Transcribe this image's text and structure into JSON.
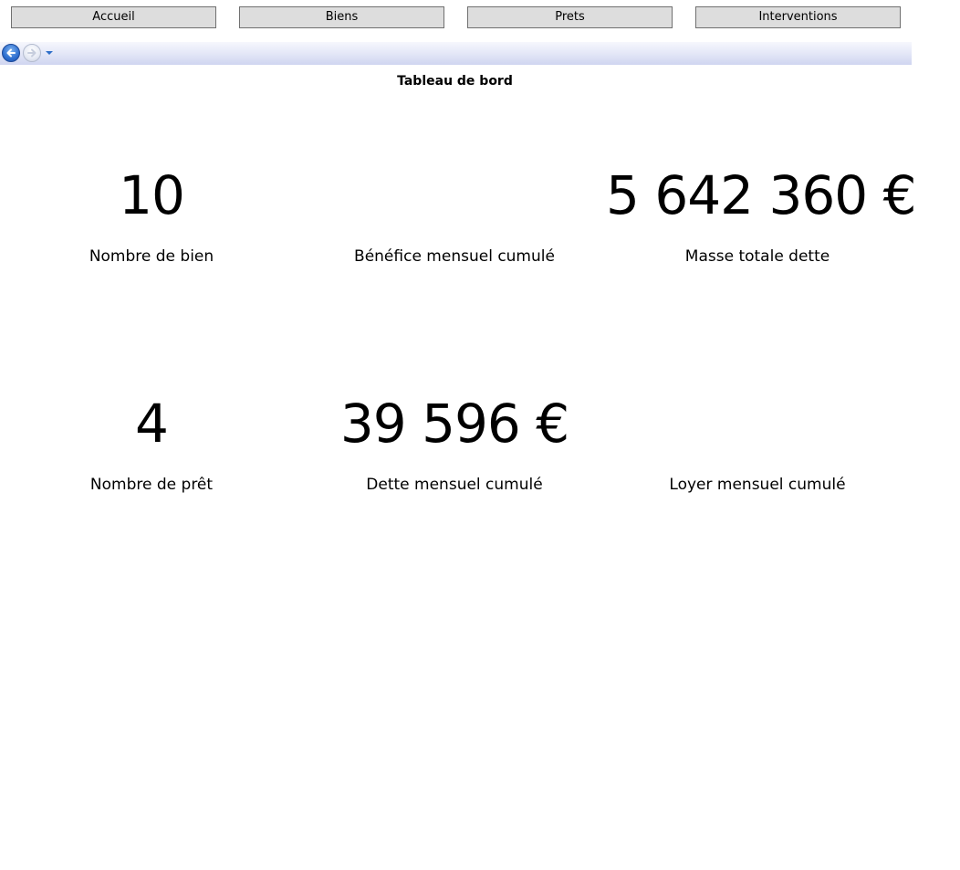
{
  "nav": {
    "accueil": "Accueil",
    "biens": "Biens",
    "prets": "Prets",
    "interventions": "Interventions"
  },
  "icons": {
    "back": "back-arrow-icon",
    "forward": "forward-arrow-icon",
    "history": "chevron-down-icon"
  },
  "page": {
    "title": "Tableau de bord"
  },
  "kpis": {
    "nombre_bien": {
      "value": "10",
      "label": "Nombre de bien"
    },
    "benefice": {
      "value": "",
      "label": "Bénéfice mensuel cumulé"
    },
    "masse_dette": {
      "value": "5 642 360 €",
      "label": "Masse totale dette"
    },
    "nombre_pret": {
      "value": "4",
      "label": "Nombre de prêt"
    },
    "dette_mensuel": {
      "value": "39 596 €",
      "label": "Dette mensuel cumulé"
    },
    "loyer": {
      "value": "",
      "label": "Loyer mensuel cumulé"
    }
  },
  "colors": {
    "button_bg": "#dddddd",
    "button_border": "#707070",
    "nav_accent": "#2e6fd0"
  }
}
